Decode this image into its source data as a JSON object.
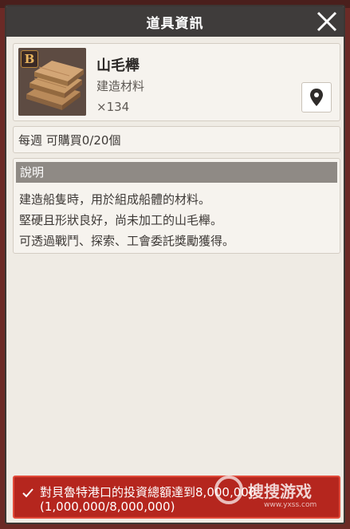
{
  "dialog": {
    "title": "道具資訊",
    "close_icon": "close-icon"
  },
  "item": {
    "grade_badge": "B",
    "name": "山毛櫸",
    "type": "建造材料",
    "count": "×134",
    "locate_icon": "map-pin-icon"
  },
  "purchase": {
    "weekly_limit": "每週 可購買0/20個"
  },
  "description": {
    "header": "說明",
    "lines": [
      "建造船隻時，用於組成船體的材料。",
      "堅硬且形狀良好，尚未加工的山毛櫸。",
      "可透過戰鬥、探索、工會委託獎勵獲得。"
    ]
  },
  "requirement": {
    "line1": "對貝魯特港口的投資總額達到8,000,000",
    "line2": "(1,000,000/8,000,000)",
    "check_icon": "check-icon"
  },
  "watermark": {
    "text": "搜搜游戏",
    "url": "www.yxss.com"
  },
  "colors": {
    "titlebar": "#3f3c3b",
    "panel": "#efebe4",
    "requirement_bg": "#b5261e",
    "desc_header": "#8f8a85"
  }
}
